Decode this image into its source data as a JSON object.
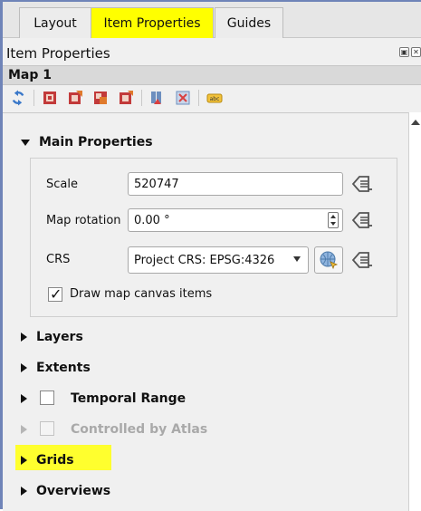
{
  "tabs": [
    {
      "label": "Layout"
    },
    {
      "label": "Item Properties",
      "highlighted": true
    },
    {
      "label": "Guides"
    }
  ],
  "panel": {
    "title": "Item Properties",
    "item_name": "Map 1",
    "title_buttons": [
      "float-icon",
      "close-icon"
    ]
  },
  "toolbar": {
    "icons": [
      "refresh-icon",
      "extent-from-canvas-icon",
      "extent-to-canvas-icon",
      "center-from-canvas-icon",
      "center-to-canvas-icon",
      "bookmarks-icon",
      "zoom-to-atlas-icon",
      "labels-icon"
    ]
  },
  "main_properties": {
    "header": "Main Properties",
    "scale_label": "Scale",
    "scale_value": "520747",
    "rotation_label": "Map rotation",
    "rotation_value": "0.00 °",
    "crs_label": "CRS",
    "crs_value": "Project CRS: EPSG:4326",
    "draw_items_label": "Draw map canvas items",
    "draw_items_checked": true
  },
  "sections": {
    "layers": "Layers",
    "extents": "Extents",
    "temporal": "Temporal Range",
    "atlas": "Controlled by Atlas",
    "grids": "Grids",
    "overviews": "Overviews"
  },
  "colors": {
    "highlight": "#ffff2e",
    "frame": "#6f84b8",
    "panel_bg": "#f0f0f0"
  }
}
